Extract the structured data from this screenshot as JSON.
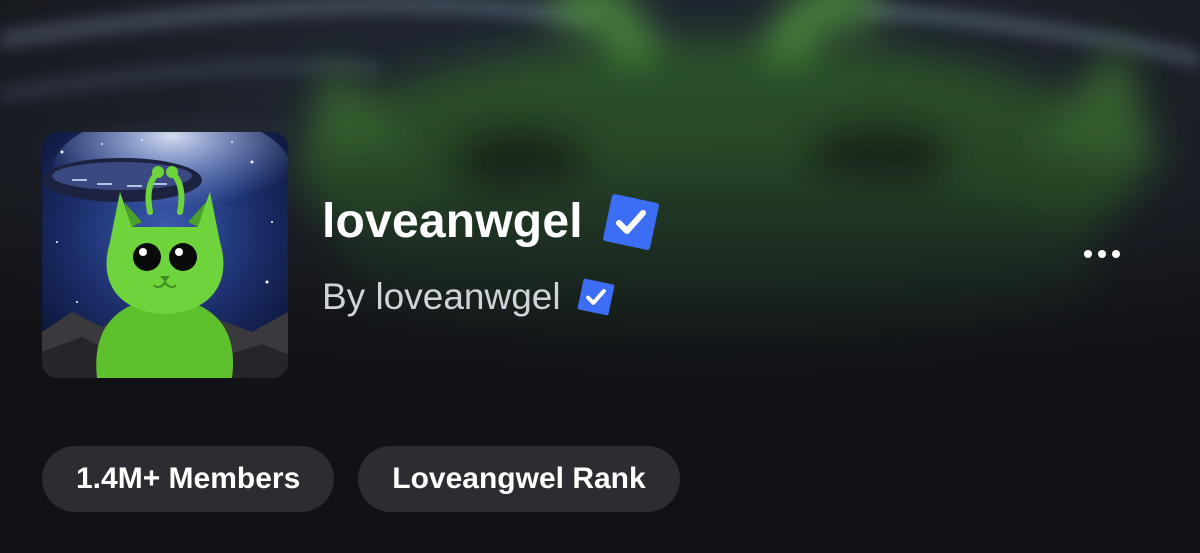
{
  "group": {
    "name": "loveanwgel",
    "owner_line": "By loveanwgel",
    "verified": true
  },
  "pills": [
    {
      "label": "1.4M+ Members"
    },
    {
      "label": "Loveangwel Rank"
    }
  ],
  "icons": {
    "verified": "verified-badge-icon",
    "more": "more-options-icon",
    "avatar": "alien-cat-group-icon"
  },
  "colors": {
    "background": "#111216",
    "verified_blue": "#3b6ef5",
    "pill_bg": "#2b2d33",
    "alien_green": "#6fd33c"
  }
}
